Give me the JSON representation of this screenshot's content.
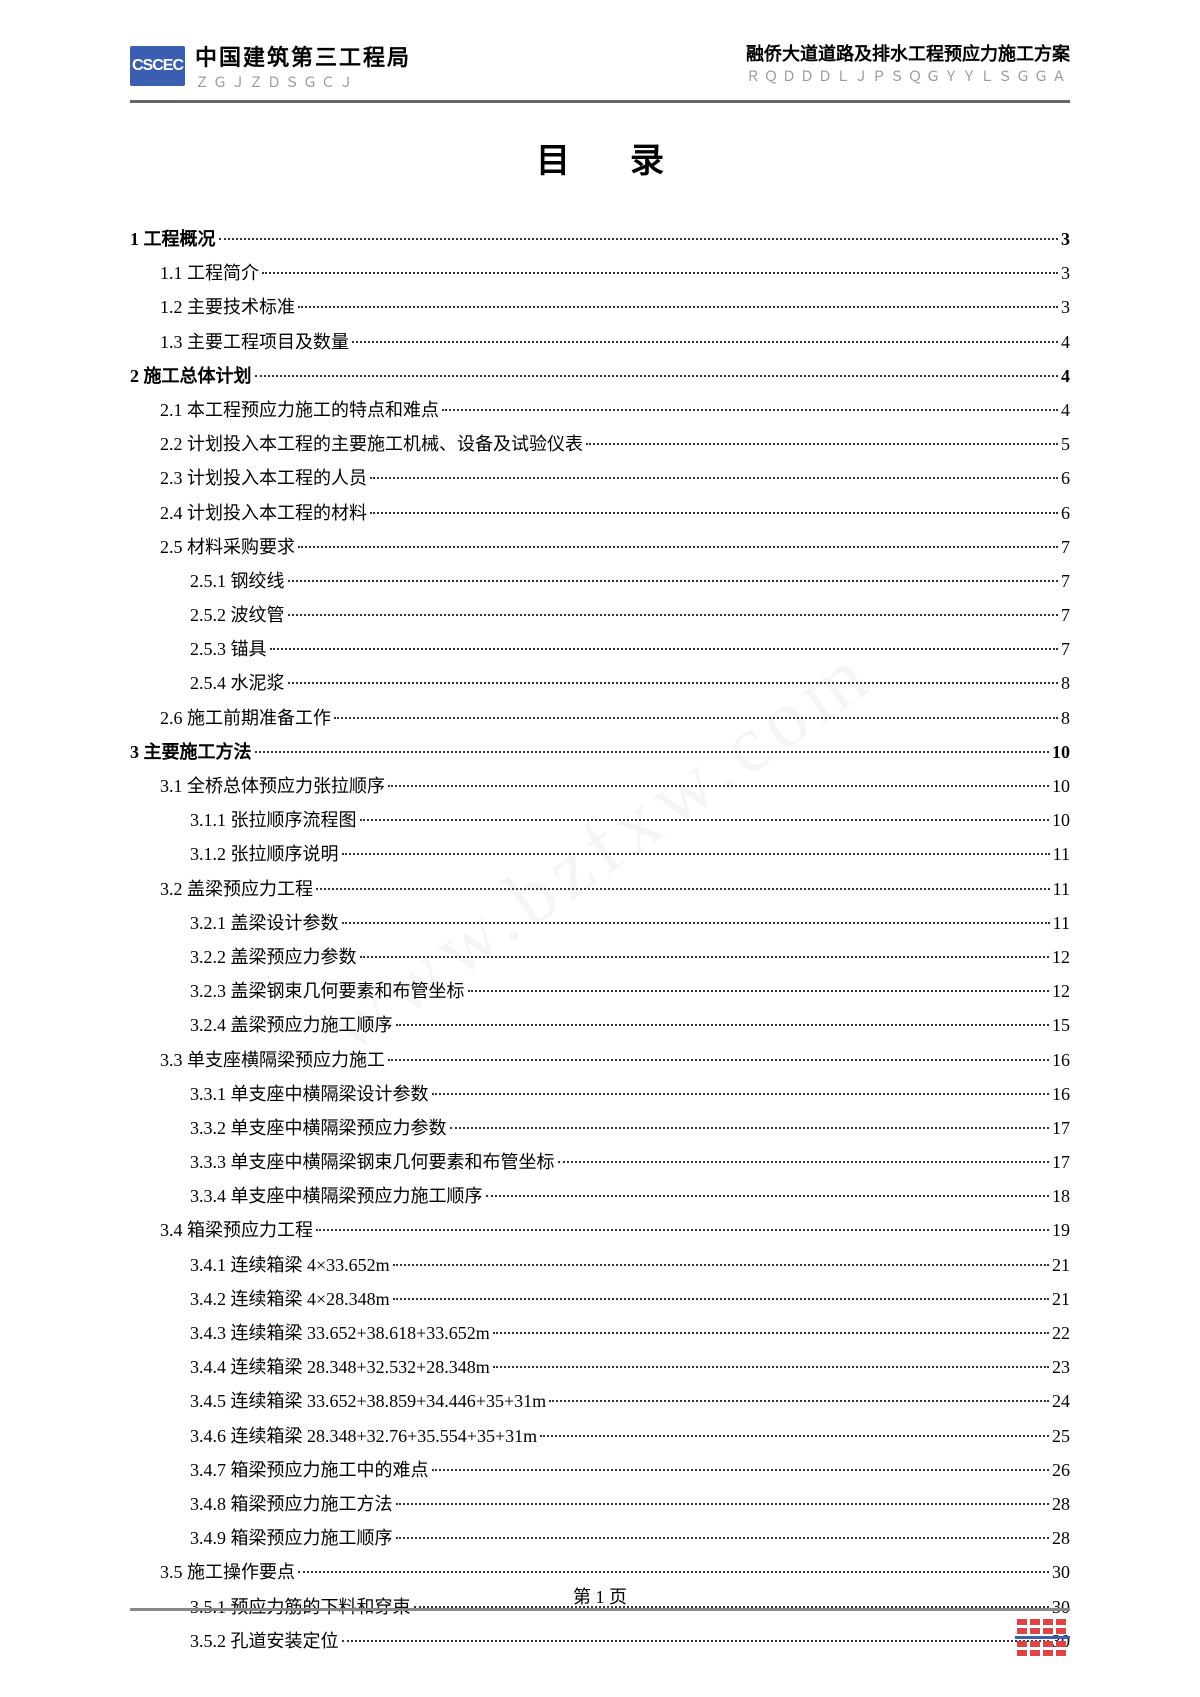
{
  "header": {
    "company_name": "中国建筑第三工程局",
    "company_pinyin": "ＺＧＪＺＤＳＧＣＪ",
    "doc_title": "融侨大道道路及排水工程预应力施工方案",
    "doc_pinyin": "ＲＱＤＤＤＬＪＰＳＱＧＹＹＬＳＧＧＡ",
    "logo_text": "CSCEC"
  },
  "toc_title": "目录",
  "toc": [
    {
      "level": 1,
      "label": "1 工程概况",
      "page": "3"
    },
    {
      "level": 2,
      "label": "1.1 工程简介",
      "page": "3"
    },
    {
      "level": 2,
      "label": "1.2 主要技术标准",
      "page": "3"
    },
    {
      "level": 2,
      "label": "1.3 主要工程项目及数量",
      "page": "4"
    },
    {
      "level": 1,
      "label": "2 施工总体计划",
      "page": "4"
    },
    {
      "level": 2,
      "label": "2.1 本工程预应力施工的特点和难点",
      "page": "4"
    },
    {
      "level": 2,
      "label": "2.2 计划投入本工程的主要施工机械、设备及试验仪表",
      "page": "5"
    },
    {
      "level": 2,
      "label": "2.3 计划投入本工程的人员",
      "page": "6"
    },
    {
      "level": 2,
      "label": "2.4 计划投入本工程的材料",
      "page": "6"
    },
    {
      "level": 2,
      "label": "2.5 材料采购要求",
      "page": "7"
    },
    {
      "level": 3,
      "label": "2.5.1 钢绞线",
      "page": "7"
    },
    {
      "level": 3,
      "label": "2.5.2 波纹管",
      "page": "7"
    },
    {
      "level": 3,
      "label": "2.5.3 锚具",
      "page": "7"
    },
    {
      "level": 3,
      "label": "2.5.4 水泥浆",
      "page": "8"
    },
    {
      "level": 2,
      "label": "2.6 施工前期准备工作",
      "page": "8"
    },
    {
      "level": 1,
      "label": "3 主要施工方法",
      "page": "10"
    },
    {
      "level": 2,
      "label": "3.1 全桥总体预应力张拉顺序",
      "page": "10"
    },
    {
      "level": 3,
      "label": "3.1.1 张拉顺序流程图",
      "page": "10"
    },
    {
      "level": 3,
      "label": "3.1.2 张拉顺序说明",
      "page": "11"
    },
    {
      "level": 2,
      "label": "3.2 盖梁预应力工程",
      "page": "11"
    },
    {
      "level": 3,
      "label": "3.2.1 盖梁设计参数",
      "page": "11"
    },
    {
      "level": 3,
      "label": "3.2.2 盖梁预应力参数",
      "page": "12"
    },
    {
      "level": 3,
      "label": "3.2.3 盖梁钢束几何要素和布管坐标",
      "page": "12"
    },
    {
      "level": 3,
      "label": "3.2.4 盖梁预应力施工顺序",
      "page": "15"
    },
    {
      "level": 2,
      "label": "3.3 单支座横隔梁预应力施工",
      "page": "16"
    },
    {
      "level": 3,
      "label": "3.3.1 单支座中横隔梁设计参数",
      "page": "16"
    },
    {
      "level": 3,
      "label": "3.3.2 单支座中横隔梁预应力参数",
      "page": "17"
    },
    {
      "level": 3,
      "label": "3.3.3 单支座中横隔梁钢束几何要素和布管坐标",
      "page": "17"
    },
    {
      "level": 3,
      "label": "3.3.4 单支座中横隔梁预应力施工顺序",
      "page": "18"
    },
    {
      "level": 2,
      "label": "3.4 箱梁预应力工程",
      "page": "19"
    },
    {
      "level": 3,
      "label": "3.4.1 连续箱梁 4×33.652m",
      "page": "21"
    },
    {
      "level": 3,
      "label": "3.4.2 连续箱梁 4×28.348m",
      "page": "21"
    },
    {
      "level": 3,
      "label": "3.4.3 连续箱梁 33.652+38.618+33.652m",
      "page": "22"
    },
    {
      "level": 3,
      "label": "3.4.4 连续箱梁 28.348+32.532+28.348m",
      "page": "23"
    },
    {
      "level": 3,
      "label": "3.4.5 连续箱梁 33.652+38.859+34.446+35+31m",
      "page": "24"
    },
    {
      "level": 3,
      "label": "3.4.6 连续箱梁 28.348+32.76+35.554+35+31m",
      "page": "25"
    },
    {
      "level": 3,
      "label": "3.4.7 箱梁预应力施工中的难点",
      "page": "26"
    },
    {
      "level": 3,
      "label": "3.4.8 箱梁预应力施工方法",
      "page": "28"
    },
    {
      "level": 3,
      "label": "3.4.9 箱梁预应力施工顺序",
      "page": "28"
    },
    {
      "level": 2,
      "label": "3.5 施工操作要点",
      "page": "30"
    },
    {
      "level": 3,
      "label": "3.5.1 预应力筋的下料和穿束",
      "page": "30"
    },
    {
      "level": 3,
      "label": "3.5.2 孔道安装定位",
      "page": "30"
    }
  ],
  "footer": {
    "page_number": "第 1 页"
  }
}
